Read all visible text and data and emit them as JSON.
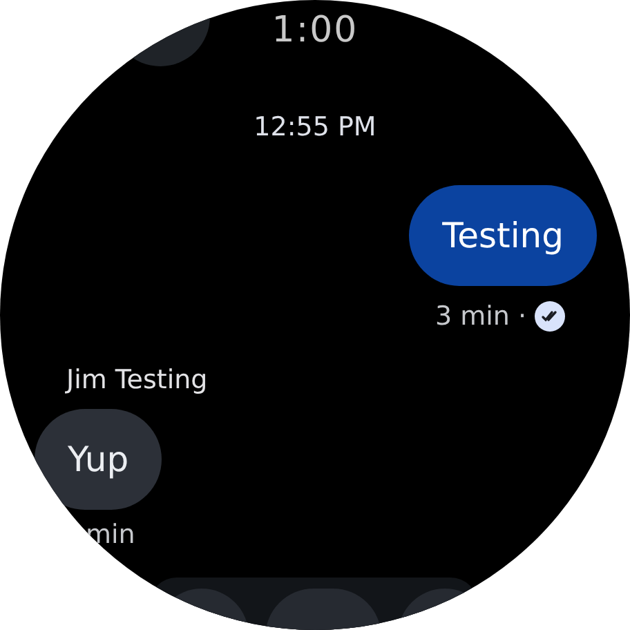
{
  "clock": "1:00",
  "timestamp": "12:55 PM",
  "messages": [
    {
      "kind": "sent",
      "text": "Testing",
      "meta": "3 min ·",
      "read": true
    },
    {
      "kind": "received",
      "sender": "Jim Testing",
      "text": "Yup",
      "meta": "min"
    }
  ]
}
